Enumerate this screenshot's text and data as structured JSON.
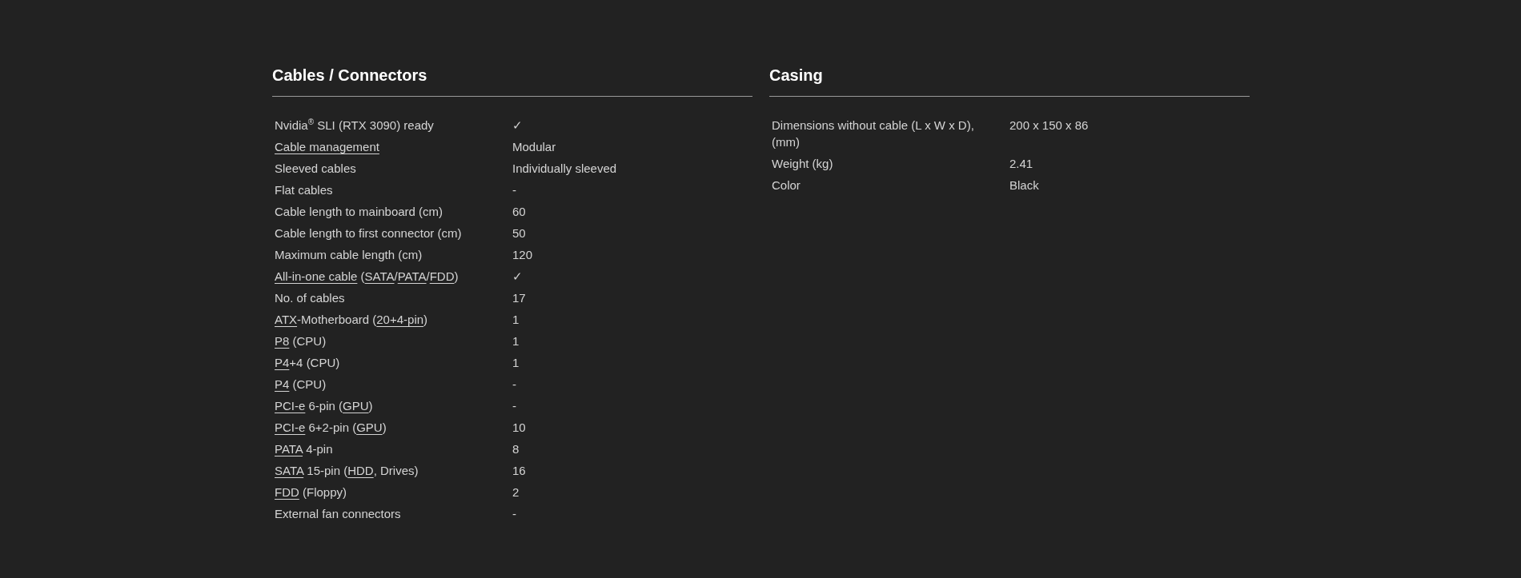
{
  "sections": [
    {
      "title": "Cables / Connectors",
      "rows": [
        {
          "label": [
            {
              "text": "Nvidia$^{®}$ SLI (RTX 3090) ready",
              "link": false
            }
          ],
          "value": "✓"
        },
        {
          "label": [
            {
              "text": "Cable management",
              "link": true
            }
          ],
          "value": "Modular"
        },
        {
          "label": [
            {
              "text": "Sleeved cables",
              "link": false
            }
          ],
          "value": "Individually sleeved"
        },
        {
          "label": [
            {
              "text": "Flat cables",
              "link": false
            }
          ],
          "value": "-"
        },
        {
          "label": [
            {
              "text": "Cable length to mainboard (cm)",
              "link": false
            }
          ],
          "value": "60"
        },
        {
          "label": [
            {
              "text": "Cable length to first connector (cm)",
              "link": false
            }
          ],
          "value": "50"
        },
        {
          "label": [
            {
              "text": "Maximum cable length (cm)",
              "link": false
            }
          ],
          "value": "120"
        },
        {
          "label": [
            {
              "text": "All-in-one cable",
              "link": true
            },
            {
              "text": " (",
              "link": false
            },
            {
              "text": "SATA",
              "link": true
            },
            {
              "text": "/",
              "link": false
            },
            {
              "text": "PATA",
              "link": true
            },
            {
              "text": "/",
              "link": false
            },
            {
              "text": "FDD",
              "link": true
            },
            {
              "text": ")",
              "link": false
            }
          ],
          "value": "✓"
        },
        {
          "label": [
            {
              "text": "No. of cables",
              "link": false
            }
          ],
          "value": "17"
        },
        {
          "label": [
            {
              "text": "ATX",
              "link": true
            },
            {
              "text": "-Motherboard (",
              "link": false
            },
            {
              "text": "20+4-pin",
              "link": true
            },
            {
              "text": ")",
              "link": false
            }
          ],
          "value": "1"
        },
        {
          "label": [
            {
              "text": "P8",
              "link": true
            },
            {
              "text": " (CPU)",
              "link": false
            }
          ],
          "value": "1"
        },
        {
          "label": [
            {
              "text": "P4",
              "link": true
            },
            {
              "text": "+4 (CPU)",
              "link": false
            }
          ],
          "value": "1"
        },
        {
          "label": [
            {
              "text": "P4",
              "link": true
            },
            {
              "text": " (CPU)",
              "link": false
            }
          ],
          "value": "-"
        },
        {
          "label": [
            {
              "text": "PCI-e",
              "link": true
            },
            {
              "text": " 6-pin (",
              "link": false
            },
            {
              "text": "GPU",
              "link": true
            },
            {
              "text": ")",
              "link": false
            }
          ],
          "value": "-"
        },
        {
          "label": [
            {
              "text": "PCI-e",
              "link": true
            },
            {
              "text": " 6+2-pin (",
              "link": false
            },
            {
              "text": "GPU",
              "link": true
            },
            {
              "text": ")",
              "link": false
            }
          ],
          "value": "10"
        },
        {
          "label": [
            {
              "text": "PATA",
              "link": true
            },
            {
              "text": " 4-pin",
              "link": false
            }
          ],
          "value": "8"
        },
        {
          "label": [
            {
              "text": "SATA",
              "link": true
            },
            {
              "text": " 15-pin (",
              "link": false
            },
            {
              "text": "HDD",
              "link": true
            },
            {
              "text": ", Drives)",
              "link": false
            }
          ],
          "value": "16"
        },
        {
          "label": [
            {
              "text": "FDD",
              "link": true
            },
            {
              "text": " (Floppy)",
              "link": false
            }
          ],
          "value": "2"
        },
        {
          "label": [
            {
              "text": "External fan connectors",
              "link": false
            }
          ],
          "value": "-"
        }
      ]
    },
    {
      "title": "Casing",
      "rows": [
        {
          "label": [
            {
              "text": "Dimensions without cable (L x W x D), (mm)",
              "link": false
            }
          ],
          "value": "200 x 150 x 86"
        },
        {
          "label": [
            {
              "text": "Weight (kg)",
              "link": false
            }
          ],
          "value": "2.41"
        },
        {
          "label": [
            {
              "text": "Color",
              "link": false
            }
          ],
          "value": "Black"
        }
      ]
    }
  ]
}
